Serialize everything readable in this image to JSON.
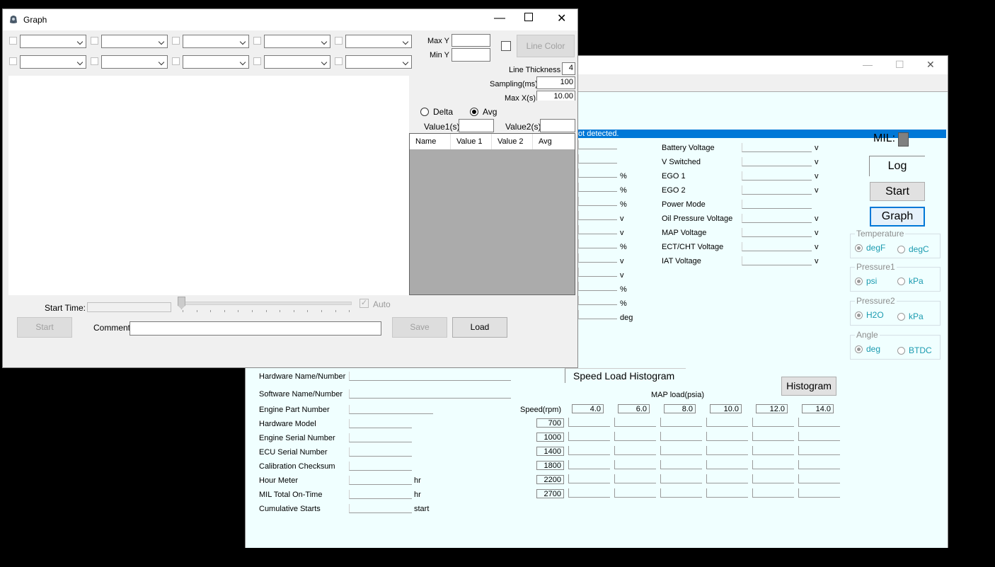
{
  "graph_window": {
    "title": "Graph",
    "max_y_label": "Max Y",
    "min_y_label": "Min Y",
    "line_color_label": "Line Color",
    "line_thickness_label": "Line Thickness",
    "line_thickness_value": "4",
    "sampling_label": "Sampling(ms)",
    "sampling_value": "100",
    "max_x_label": "Max X(s)",
    "max_x_value": "10.00",
    "delta_label": "Delta",
    "avg_label": "Avg",
    "value1_label": "Value1(s)",
    "value2_label": "Value2(s)",
    "table_headers": [
      "Name",
      "Value 1",
      "Value 2",
      "Avg"
    ],
    "start_time_label": "Start Time:",
    "auto_label": "Auto",
    "start_button": "Start",
    "comment_label": "Comment:",
    "save_button": "Save",
    "load_button": "Load"
  },
  "main_window": {
    "status_text": "ot detected.",
    "mil_label": "MIL:",
    "log_label": "Log",
    "start_button": "Start",
    "graph_button": "Graph",
    "left_units": [
      "%",
      "%",
      "%",
      "v",
      "v",
      "%",
      "v",
      "v",
      "%",
      "%",
      "deg"
    ],
    "sensors": [
      {
        "label": "Battery Voltage",
        "unit": "v"
      },
      {
        "label": "V Switched",
        "unit": "v"
      },
      {
        "label": "EGO 1",
        "unit": "v"
      },
      {
        "label": "EGO 2",
        "unit": "v"
      },
      {
        "label": "Power Mode",
        "unit": ""
      },
      {
        "label": "Oil Pressure Voltage",
        "unit": "v"
      },
      {
        "label": "MAP Voltage",
        "unit": "v"
      },
      {
        "label": "ECT/CHT Voltage",
        "unit": "v"
      },
      {
        "label": "IAT Voltage",
        "unit": "v"
      }
    ],
    "temperature": {
      "title": "Temperature",
      "opt1": "degF",
      "opt2": "degC"
    },
    "pressure1": {
      "title": "Pressure1",
      "opt1": "psi",
      "opt2": "kPa"
    },
    "pressure2": {
      "title": "Pressure2",
      "opt1": "H2O",
      "opt2": "kPa"
    },
    "angle": {
      "title": "Angle",
      "opt1": "deg",
      "opt2": "BTDC"
    },
    "ecu_info": [
      {
        "label": "Hardware Name/Number",
        "unit": ""
      },
      {
        "label": "Software Name/Number",
        "unit": ""
      },
      {
        "label": "Engine Part Number",
        "unit": ""
      },
      {
        "label": "Hardware Model",
        "unit": ""
      },
      {
        "label": "Engine Serial Number",
        "unit": ""
      },
      {
        "label": "ECU Serial Number",
        "unit": ""
      },
      {
        "label": "Calibration Checksum",
        "unit": ""
      },
      {
        "label": "Hour Meter",
        "unit": "hr"
      },
      {
        "label": "MIL Total On-Time",
        "unit": "hr"
      },
      {
        "label": "Cumulative Starts",
        "unit": "start"
      }
    ],
    "histogram": {
      "title": "Speed Load Histogram",
      "button": "Histogram",
      "map_load_label": "MAP load(psia)",
      "speed_label": "Speed(rpm)",
      "load_values": [
        "4.0",
        "6.0",
        "8.0",
        "10.0",
        "12.0",
        "14.0"
      ],
      "speed_values": [
        "700",
        "1000",
        "1400",
        "1800",
        "2200",
        "2700"
      ]
    }
  }
}
